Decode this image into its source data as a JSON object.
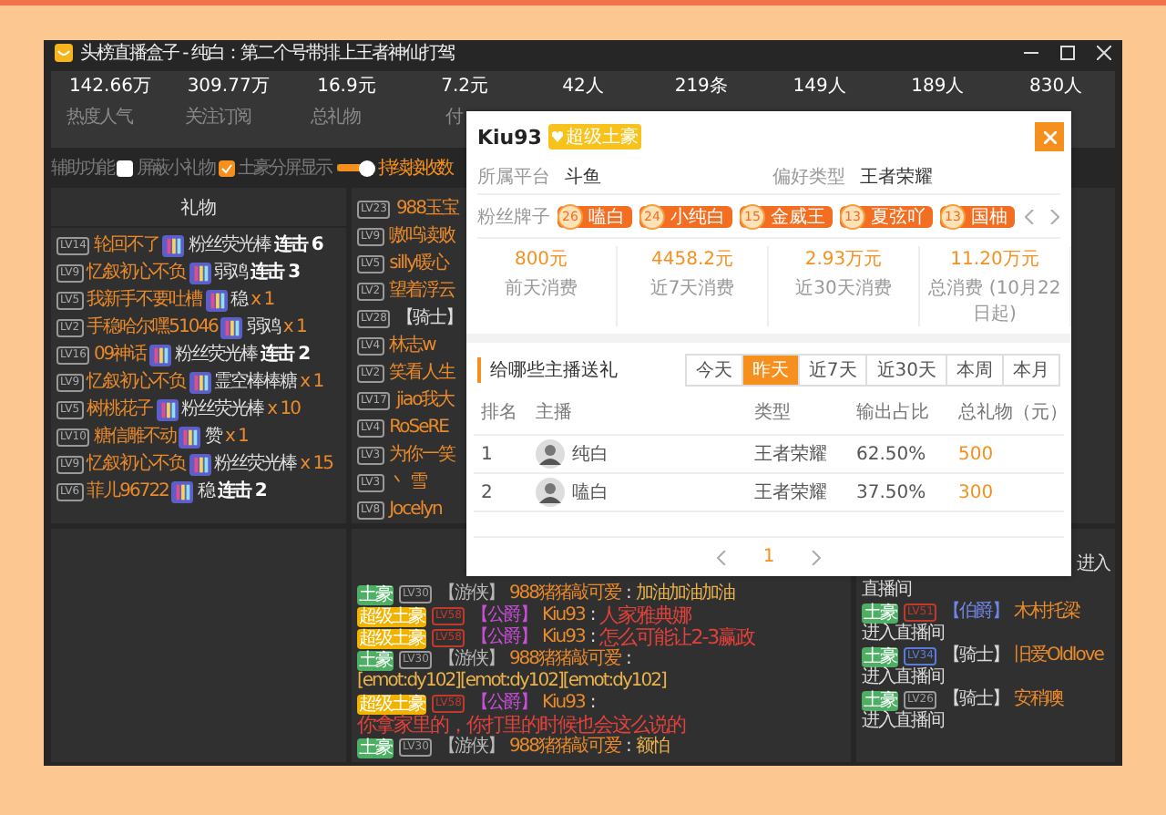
{
  "window": {
    "title": "头榜直播盒子 - 纯白：第二个号带排上王者神仙打驾"
  },
  "stats": [
    {
      "value": "142.66万",
      "label": "热度人气"
    },
    {
      "value": "309.77万",
      "label": "关注订阅"
    },
    {
      "value": "16.9元",
      "label": "总礼物"
    },
    {
      "value": "7.2元",
      "label": "付"
    },
    {
      "value": "42人"
    },
    {
      "value": "219条"
    },
    {
      "value": "149人"
    },
    {
      "value": "189人"
    },
    {
      "value": "830人"
    }
  ],
  "options": {
    "label": "辅助功能",
    "checkboxes": [
      {
        "label": "屏蔽小礼物",
        "checked": false
      },
      {
        "label": "土豪分屏显示",
        "checked": true
      }
    ],
    "slider": {
      "level": 0.8
    },
    "slider_label": "持续接收数"
  },
  "gift_panel": {
    "title": "礼物",
    "rows": [
      {
        "level": "LV14",
        "user": "轮回不了",
        "gift": "粉丝荧光棒",
        "kind": "combo",
        "count": "连击 6"
      },
      {
        "level": "LV9",
        "user": "忆叙初心不负",
        "gift": "弱鸡",
        "kind": "combo",
        "count": "连击 3"
      },
      {
        "level": "LV5",
        "user": "我新手不要吐槽",
        "gift": "稳",
        "kind": "plain",
        "count": "x 1"
      },
      {
        "level": "LV2",
        "user": "手稳哈尔嘿51046",
        "gift": "弱鸡",
        "kind": "plain",
        "count": "x 1"
      },
      {
        "level": "LV16",
        "user": "09神话",
        "gift": "粉丝荧光棒",
        "kind": "combo",
        "count": "连击 2"
      },
      {
        "level": "LV9",
        "user": "忆叙初心不负",
        "gift": "霊空棒棒糖",
        "kind": "plain",
        "count": "x 1"
      },
      {
        "level": "LV5",
        "user": "树桃花子",
        "gift": "粉丝荧光棒",
        "kind": "plain",
        "count": "x 10"
      },
      {
        "level": "LV10",
        "user": "糖信雕不动",
        "gift": "赞",
        "kind": "plain",
        "count": "x 1"
      },
      {
        "level": "LV9",
        "user": "忆叙初心不负",
        "gift": "粉丝荧光棒",
        "kind": "plain",
        "count": "x 15"
      },
      {
        "level": "LV6",
        "user": "菲儿96722",
        "gift": "稳",
        "kind": "combo",
        "count": "连击 2"
      }
    ]
  },
  "chat": {
    "rows": [
      {
        "level": "LV23",
        "user": "988玉宝"
      },
      {
        "level": "LV9",
        "user": "嗷呜读败"
      },
      {
        "level": "LV5",
        "user": "silly暖心"
      },
      {
        "level": "LV2",
        "user": "望着浮云"
      },
      {
        "level": "LV28",
        "tag": "【骑士】"
      },
      {
        "level": "LV4",
        "user": "林志w"
      },
      {
        "level": "LV2",
        "user": "笑看人生"
      },
      {
        "level": "LV17",
        "user": "jiao我大"
      },
      {
        "level": "LV4",
        "user": "RoSeRE"
      },
      {
        "level": "LV3",
        "user": "为你一笑"
      },
      {
        "level": "LV3",
        "user": "丶 雪"
      },
      {
        "level": "LV8",
        "user": "Jocelyn"
      }
    ]
  },
  "vip_chat": {
    "rows": [
      {
        "badge": {
          "text": "土豪",
          "color": "#4caf63"
        },
        "level": {
          "text": "LV30",
          "color": "#9a9a9a"
        },
        "tag": {
          "text": "【游侠】",
          "color": "#b8b8b8"
        },
        "user": "988猪猪敲可爱",
        "sep": ":",
        "message": "加油加油加油",
        "highlight": false
      },
      {
        "badge": {
          "text": "超级土豪",
          "color": "#f2b200"
        },
        "level": {
          "text": "LV58",
          "color": "#c0392b"
        },
        "tag": {
          "text": "【公爵】",
          "color": "#c94fd8"
        },
        "user": "Kiu93",
        "sep": ":",
        "message": "人家雅典娜",
        "highlight": true
      },
      {
        "badge": {
          "text": "超级土豪",
          "color": "#f2b200"
        },
        "level": {
          "text": "LV58",
          "color": "#c0392b"
        },
        "tag": {
          "text": "【公爵】",
          "color": "#c94fd8"
        },
        "user": "Kiu93",
        "sep": ":",
        "message": "怎么可能让2-3赢政",
        "highlight": true
      },
      {
        "badge": {
          "text": "土豪",
          "color": "#4caf63"
        },
        "level": {
          "text": "LV30",
          "color": "#9a9a9a"
        },
        "tag": {
          "text": "【游侠】",
          "color": "#b8b8b8"
        },
        "user": "988猪猪敲可爱",
        "sep": ":",
        "message": "[emot:dy102][emot:dy102][emot:dy102]",
        "highlight": false
      },
      {
        "badge": {
          "text": "超级土豪",
          "color": "#f2b200"
        },
        "level": {
          "text": "LV58",
          "color": "#c0392b"
        },
        "tag": {
          "text": "【公爵】",
          "color": "#c94fd8"
        },
        "user": "Kiu93",
        "sep": ":",
        "message": "你拿家里的，你打里的时候也会这么说的",
        "highlight": true
      },
      {
        "badge": {
          "text": "土豪",
          "color": "#4caf63"
        },
        "level": {
          "text": "LV30",
          "color": "#9a9a9a"
        },
        "tag": {
          "text": "【游侠】",
          "color": "#b8b8b8"
        },
        "user": "988猪猪敲可爱",
        "sep": ":",
        "message": "额怕",
        "highlight": false
      }
    ]
  },
  "entries": {
    "partial": [
      "进入",
      "直播间"
    ],
    "rows": [
      {
        "badge": {
          "text": "土豪",
          "color": "#4caf63"
        },
        "level": {
          "text": "LV51",
          "color": "#c0392b"
        },
        "tag": {
          "text": "【伯爵】",
          "color": "#6f86e8"
        },
        "user": "木村托梁",
        "action": "进入直播间"
      },
      {
        "badge": {
          "text": "土豪",
          "color": "#4caf63"
        },
        "level": {
          "text": "LV34",
          "color": "#5b7bd8"
        },
        "tag": {
          "text": "【骑士】",
          "color": "#d8d8d8"
        },
        "user": "旧爱Oldlove",
        "action": "进入直播间"
      },
      {
        "badge": {
          "text": "土豪",
          "color": "#4caf63"
        },
        "level": {
          "text": "LV26",
          "color": "#9a9a9a"
        },
        "tag": {
          "text": "【骑士】",
          "color": "#d8d8d8"
        },
        "user": "安稍噢",
        "action": "进入直播间"
      }
    ]
  },
  "popup": {
    "name": "Kiu93",
    "badge": "超级土豪",
    "info": [
      {
        "label": "所属平台",
        "value": "斗鱼"
      },
      {
        "label": "偏好类型",
        "value": "王者荣耀"
      }
    ],
    "medals_label": "粉丝牌子",
    "medals": [
      {
        "level": "26",
        "name": "嗑白"
      },
      {
        "level": "24",
        "name": "小纯白"
      },
      {
        "level": "15",
        "name": "金威王"
      },
      {
        "level": "13",
        "name": "夏弦吖"
      },
      {
        "level": "13",
        "name": "国柚"
      }
    ],
    "spend": [
      {
        "value": "800元",
        "label": "前天消费"
      },
      {
        "value": "4458.2元",
        "label": "近7天消费"
      },
      {
        "value": "2.93万元",
        "label": "近30天消费"
      },
      {
        "value": "11.20万元",
        "label": "总消费 (10月22日起)"
      }
    ],
    "section_title": "给哪些主播送礼",
    "tabs": [
      {
        "label": "今天",
        "selected": false
      },
      {
        "label": "昨天",
        "selected": true
      },
      {
        "label": "近7天",
        "selected": false
      },
      {
        "label": "近30天",
        "selected": false
      },
      {
        "label": "本周",
        "selected": false
      },
      {
        "label": "本月",
        "selected": false
      }
    ],
    "columns": [
      "排名",
      "主播",
      "类型",
      "输出占比",
      "总礼物（元）"
    ],
    "rows": [
      {
        "rank": "1",
        "streamer": "纯白",
        "type": "王者荣耀",
        "share": "62.50%",
        "total": "500"
      },
      {
        "rank": "2",
        "streamer": "嗑白",
        "type": "王者荣耀",
        "share": "37.50%",
        "total": "300"
      }
    ],
    "page": "1"
  }
}
